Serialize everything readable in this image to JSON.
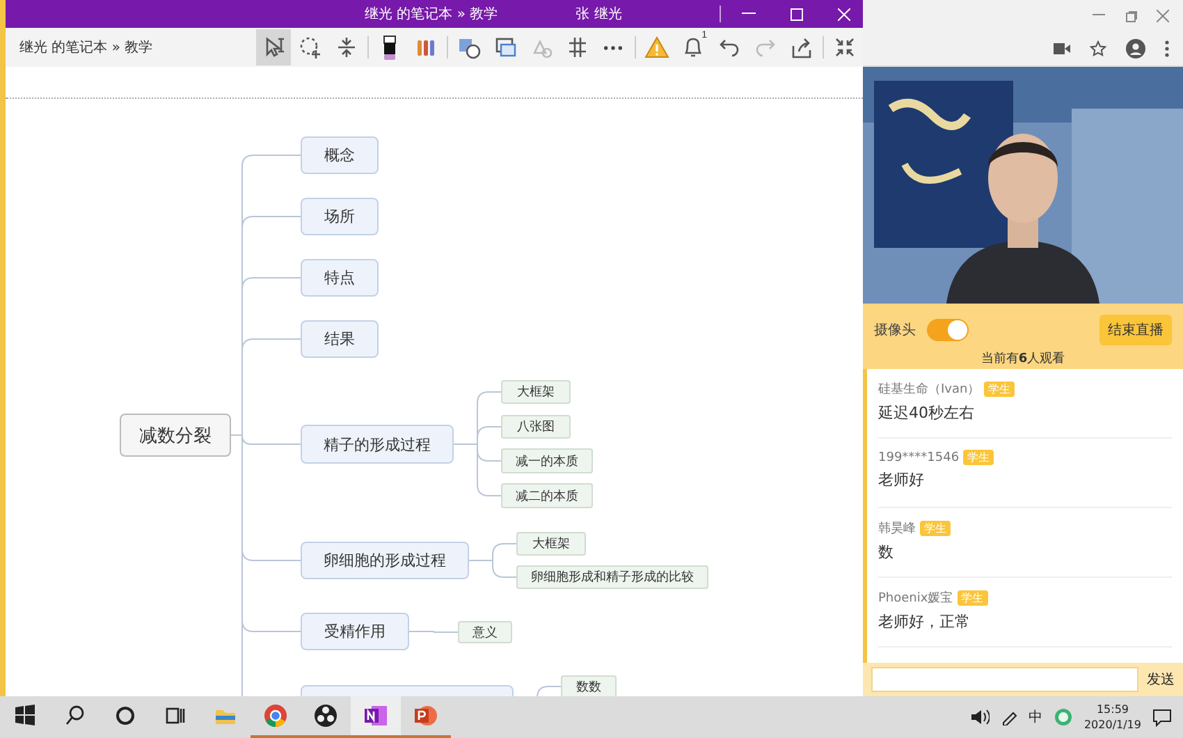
{
  "window": {
    "title": "继光 的笔记本 » 教学",
    "user": "张 继光"
  },
  "toolbar": {
    "breadcrumb": "继光 的笔记本 » 教学",
    "tools": [
      {
        "kind": "select",
        "selected": true,
        "disabled": false
      },
      {
        "kind": "lasso",
        "selected": false,
        "disabled": false
      },
      {
        "kind": "space",
        "selected": false,
        "disabled": false
      },
      {
        "kind": "pen",
        "selected": false,
        "disabled": false
      },
      {
        "kind": "pens",
        "selected": false,
        "disabled": false
      },
      {
        "kind": "shapes",
        "selected": false,
        "disabled": false
      },
      {
        "kind": "clip",
        "selected": false,
        "disabled": false
      },
      {
        "kind": "inkshape",
        "selected": false,
        "disabled": true
      },
      {
        "kind": "grid",
        "selected": false,
        "disabled": false
      },
      {
        "kind": "more",
        "selected": false,
        "disabled": false
      },
      {
        "kind": "warning",
        "selected": false,
        "disabled": false
      },
      {
        "kind": "bell",
        "selected": false,
        "disabled": false,
        "badge": "1"
      },
      {
        "kind": "undo",
        "selected": false,
        "disabled": false
      },
      {
        "kind": "redo",
        "selected": false,
        "disabled": true
      },
      {
        "kind": "share",
        "selected": false,
        "disabled": false
      },
      {
        "kind": "collapse",
        "selected": false,
        "disabled": false
      }
    ]
  },
  "mindmap": {
    "root": {
      "label": "减数分裂",
      "children": [
        {
          "label": "概念"
        },
        {
          "label": "场所"
        },
        {
          "label": "特点"
        },
        {
          "label": "结果"
        },
        {
          "label": "精子的形成过程",
          "children": [
            {
              "label": "大框架"
            },
            {
              "label": "八张图"
            },
            {
              "label": "减一的本质"
            },
            {
              "label": "减二的本质"
            }
          ]
        },
        {
          "label": "卵细胞的形成过程",
          "children": [
            {
              "label": "大框架"
            },
            {
              "label": "卵细胞形成和精子形成的比较"
            }
          ]
        },
        {
          "label": "受精作用",
          "children": [
            {
              "label": "意义"
            }
          ]
        },
        {
          "children": [
            {
              "label": "数数"
            }
          ]
        }
      ]
    }
  },
  "live": {
    "camera_label": "摄像头",
    "camera_on": true,
    "end_button": "结束直播",
    "viewers": "当前有**6**人观看",
    "messages": [
      {
        "name": "硅基生命（Ivan）",
        "badge": "学生",
        "text": "延迟40秒左右"
      },
      {
        "name": "199****1546",
        "badge": "学生",
        "text": "老师好"
      },
      {
        "name": "韩昊峰",
        "badge": "学生",
        "text": "数"
      },
      {
        "name": "Phoenix媛宝",
        "badge": "学生",
        "text": "老师好，正常"
      }
    ],
    "send_button": "发送"
  },
  "taskbar": {
    "apps": [
      {
        "kind": "start",
        "running": false,
        "active": false
      },
      {
        "kind": "search",
        "running": false,
        "active": false
      },
      {
        "kind": "cortana",
        "running": false,
        "active": false
      },
      {
        "kind": "taskview",
        "running": false,
        "active": false
      },
      {
        "kind": "explorer",
        "running": false,
        "active": false
      },
      {
        "kind": "chrome",
        "running": true,
        "active": false
      },
      {
        "kind": "obs",
        "running": true,
        "active": false
      },
      {
        "kind": "onenote",
        "running": true,
        "active": true
      },
      {
        "kind": "powerpoint",
        "running": true,
        "active": false
      }
    ],
    "tray": {
      "ime": "中",
      "time": "15:59",
      "date": "2020/1/19"
    }
  }
}
